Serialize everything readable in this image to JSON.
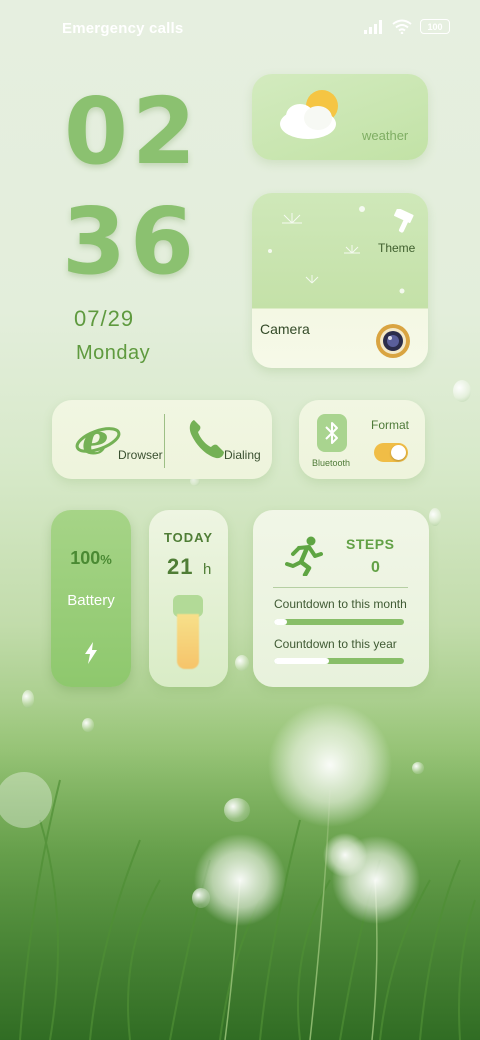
{
  "status_bar": {
    "carrier_text": "Emergency calls",
    "battery_level": "100",
    "icons": [
      "signal-icon",
      "wifi-icon",
      "battery-icon"
    ]
  },
  "clock": {
    "hour": "02",
    "minute": "36",
    "date": "07/29",
    "weekday": "Monday"
  },
  "widgets": {
    "weather": {
      "label": "weather",
      "icon": "weather-icon"
    },
    "photo": {
      "theme_label": "Theme",
      "camera_label": "Camera",
      "icons": [
        "theme-brush-icon",
        "camera-lens-icon"
      ]
    },
    "apps": {
      "browser_label": "Drowser",
      "dialing_label": "Dialing",
      "icons": [
        "browser-icon",
        "phone-icon"
      ]
    },
    "toggles": {
      "bluetooth_label": "Bluetooth",
      "format_label": "Format",
      "format_on": true,
      "icons": [
        "bluetooth-icon"
      ]
    },
    "battery": {
      "value": "100",
      "unit": "%",
      "label": "Battery",
      "icon": "charging-bolt-icon"
    },
    "today": {
      "label": "TODAY",
      "value": "21",
      "unit": "h"
    },
    "steps": {
      "label": "STEPS",
      "value": "0",
      "icon": "running-person-icon",
      "countdown_month_label": "Countdown to this month",
      "countdown_year_label": "Countdown to this year",
      "countdown_month_fraction": 0.1,
      "countdown_year_fraction": 0.42
    }
  },
  "colors": {
    "accent_green": "#8bc170",
    "text_green": "#5f9a3f",
    "toggle_on": "#f0bd46"
  }
}
